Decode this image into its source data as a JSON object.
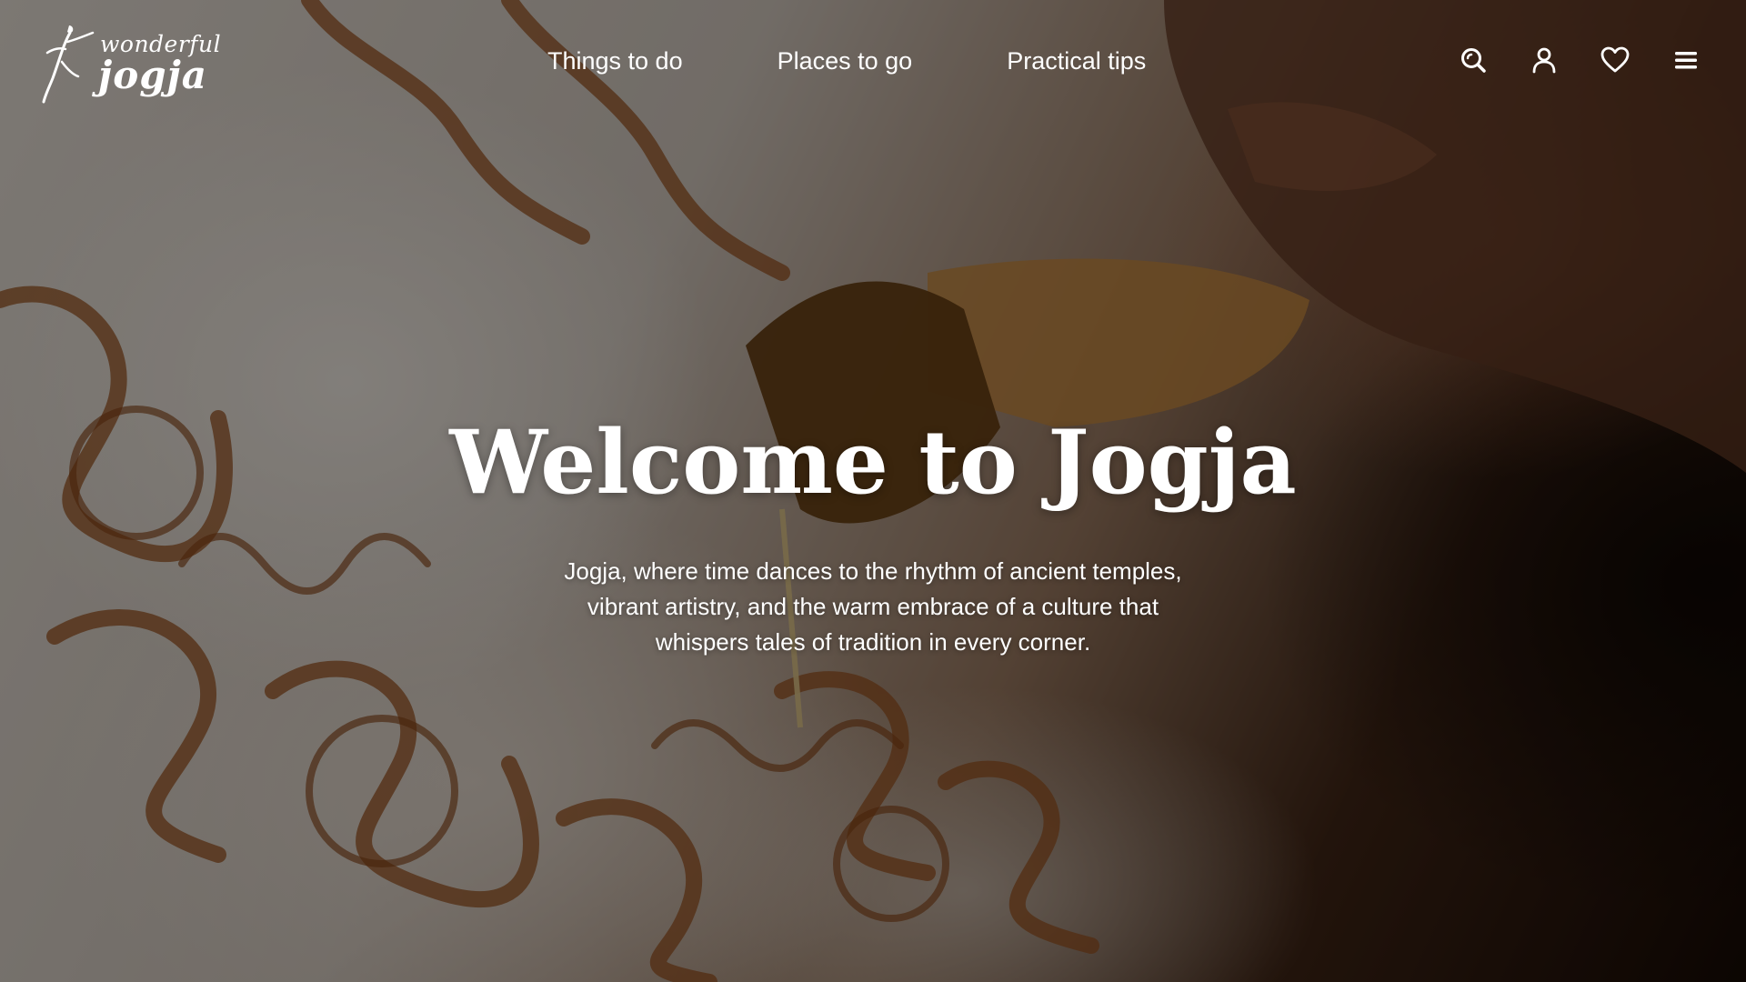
{
  "brand": {
    "logo_top": "wonderful",
    "logo_bottom": "jogja"
  },
  "nav": {
    "items": [
      {
        "label": "Things to do"
      },
      {
        "label": "Places to go"
      },
      {
        "label": "Practical tips"
      }
    ]
  },
  "header_icons": [
    "search-icon",
    "user-icon",
    "heart-icon",
    "menu-icon"
  ],
  "hero": {
    "title": "Welcome to Jogja",
    "subtitle": "Jogja, where time dances to the rhythm of ancient temples, vibrant artistry, and the warm embrace of a culture that whispers tales of tradition in every corner."
  },
  "colors": {
    "text": "#ffffff",
    "batik_brown": "#8a4a1c"
  }
}
